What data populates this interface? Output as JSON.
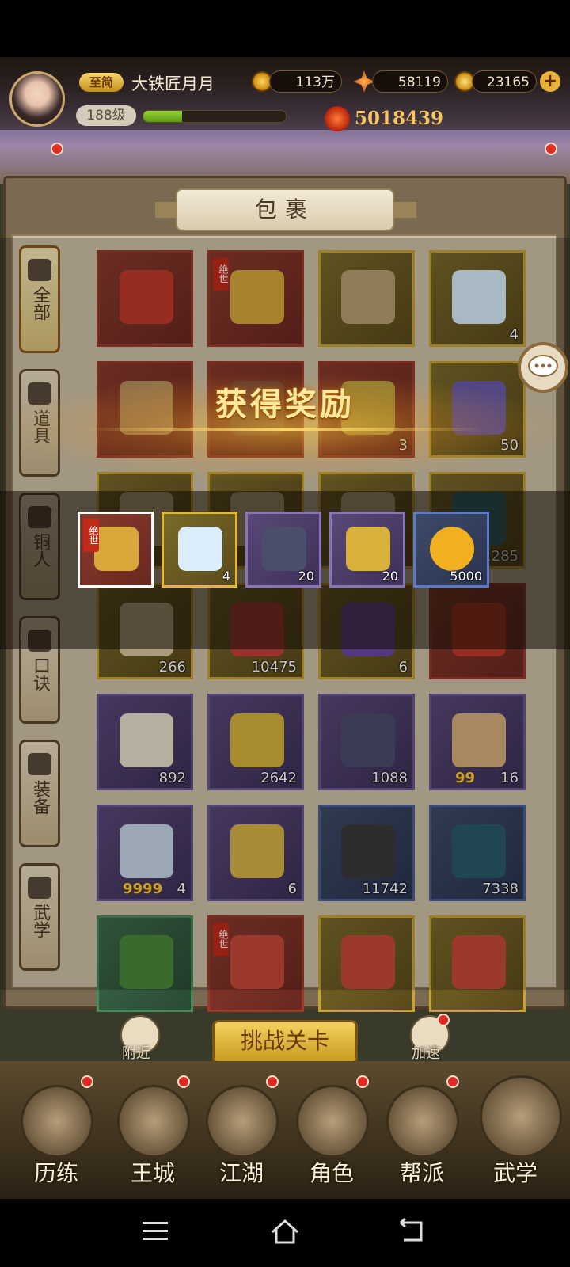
{
  "player": {
    "vip": "至简",
    "name": "大铁匠月月",
    "level": "188级",
    "exp_fraction": 0.27,
    "power": "5018439"
  },
  "resources": {
    "copper": "113万",
    "ingots_a": "58119",
    "gold": "23165"
  },
  "panel": {
    "title": "包裹"
  },
  "side_tabs": [
    {
      "label": "全部",
      "active": true
    },
    {
      "label": "道具",
      "active": false
    },
    {
      "label": "铜人",
      "active": false
    },
    {
      "label": "口诀",
      "active": false
    },
    {
      "label": "装备",
      "active": false
    },
    {
      "label": "武学",
      "active": false
    }
  ],
  "grid": [
    [
      {
        "rarity": "red",
        "count": "",
        "badge": "",
        "cap": "",
        "art": "red-envelope"
      },
      {
        "rarity": "red",
        "count": "",
        "badge": "绝世",
        "cap": "",
        "art": "golden-chest"
      },
      {
        "rarity": "gold",
        "count": "",
        "badge": "",
        "cap": "",
        "art": "scroll-table"
      },
      {
        "rarity": "gold",
        "count": "4",
        "badge": "",
        "cap": "",
        "art": "mochi"
      }
    ],
    [
      {
        "rarity": "red",
        "count": "",
        "badge": "",
        "cap": "",
        "art": "token"
      },
      {
        "rarity": "red",
        "count": "",
        "badge": "",
        "cap": "",
        "art": "unknown"
      },
      {
        "rarity": "red",
        "count": "3",
        "badge": "",
        "cap": "",
        "art": "leaf"
      },
      {
        "rarity": "gold",
        "count": "50",
        "badge": "",
        "cap": "",
        "art": "pinwheel"
      }
    ],
    [
      {
        "rarity": "gold",
        "count": "",
        "badge": "",
        "cap": "",
        "art": "book"
      },
      {
        "rarity": "gold",
        "count": "",
        "badge": "",
        "cap": "",
        "art": "book"
      },
      {
        "rarity": "gold",
        "count": "",
        "badge": "",
        "cap": "",
        "art": "book"
      },
      {
        "rarity": "gold",
        "count": "1285",
        "badge": "",
        "cap": "",
        "art": "orb"
      }
    ],
    [
      {
        "rarity": "gold",
        "count": "266",
        "badge": "",
        "cap": "",
        "art": "scroll"
      },
      {
        "rarity": "gold",
        "count": "10475",
        "badge": "",
        "cap": "",
        "art": "red-orb"
      },
      {
        "rarity": "gold",
        "count": "6",
        "badge": "",
        "cap": "",
        "art": "seal"
      },
      {
        "rarity": "red",
        "count": "",
        "badge": "",
        "cap": "",
        "art": "banner"
      }
    ],
    [
      {
        "rarity": "purple",
        "count": "892",
        "badge": "",
        "cap": "",
        "art": "paper"
      },
      {
        "rarity": "purple",
        "count": "2642",
        "badge": "",
        "cap": "",
        "art": "gold-star"
      },
      {
        "rarity": "purple",
        "count": "1088",
        "badge": "",
        "cap": "",
        "art": "ore"
      },
      {
        "rarity": "purple",
        "count": "16",
        "badge": "",
        "cap": "99",
        "art": "shell"
      }
    ],
    [
      {
        "rarity": "purple",
        "count": "4",
        "badge": "",
        "cap": "9999",
        "art": "cloud"
      },
      {
        "rarity": "purple",
        "count": "6",
        "badge": "",
        "cap": "",
        "art": "gold-rock"
      },
      {
        "rarity": "blue",
        "count": "11742",
        "badge": "",
        "cap": "",
        "art": "flute"
      },
      {
        "rarity": "blue",
        "count": "7338",
        "badge": "",
        "cap": "",
        "art": "jade"
      }
    ],
    [
      {
        "rarity": "green",
        "count": "",
        "badge": "",
        "cap": "",
        "art": "bamboo"
      },
      {
        "rarity": "red",
        "count": "",
        "badge": "绝世",
        "cap": "",
        "art": "manual"
      },
      {
        "rarity": "gold",
        "count": "",
        "badge": "",
        "cap": "",
        "art": "manual"
      },
      {
        "rarity": "gold",
        "count": "",
        "badge": "",
        "cap": "",
        "art": "manual"
      }
    ]
  ],
  "reward": {
    "title": "获得奖励",
    "items": [
      {
        "rarity": "red",
        "count": "",
        "badge": "绝世"
      },
      {
        "rarity": "gold",
        "count": "4",
        "badge": ""
      },
      {
        "rarity": "purple",
        "count": "20",
        "badge": ""
      },
      {
        "rarity": "purple",
        "count": "20",
        "badge": ""
      },
      {
        "rarity": "blue",
        "count": "5000",
        "badge": ""
      }
    ]
  },
  "bottom": {
    "nearby": "附近",
    "challenge": "挑战关卡",
    "speedup": "加速"
  },
  "nav": [
    "历练",
    "王城",
    "江湖",
    "角色",
    "帮派",
    "武学"
  ],
  "colors": {
    "red_dot": "#e02b24",
    "gold": "#f7c766"
  }
}
